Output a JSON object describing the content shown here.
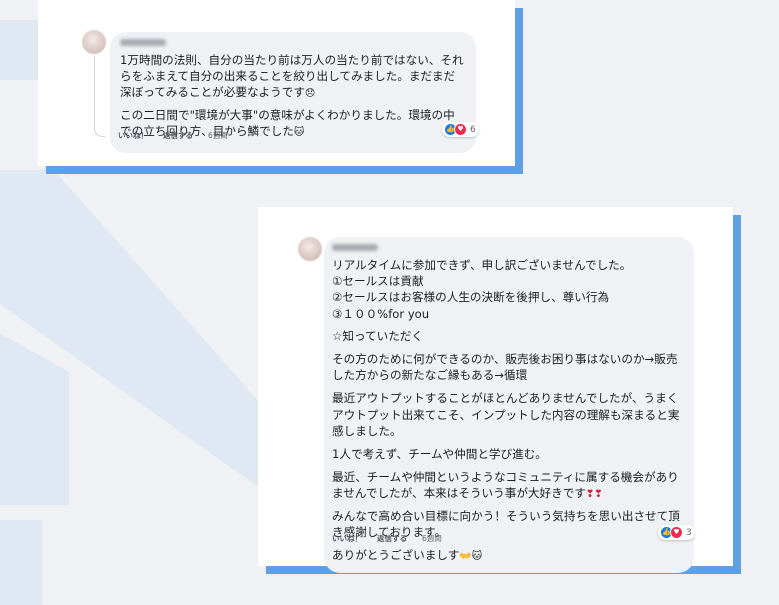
{
  "colors": {
    "page_bg": "#eff1f4",
    "card_shadow": "#5f9fe3",
    "bubble_bg": "#eff1f4",
    "like_blue": "#1877f2",
    "love_red": "#f0284a"
  },
  "comment1": {
    "author_blurred": true,
    "paragraphs": [
      "1万時間の法則、自分の当たり前は万人の当たり前ではない、それらをふまえて自分の出来ることを絞り出してみました。まだまだ深ぼってみることが必要なようです",
      "この二日間で\"環境が大事\"の意味がよくわかりました。環境の中での立ち回り方、目から鱗でした"
    ],
    "emoji": [
      "😞",
      "🐱"
    ],
    "reaction_count": "6",
    "actions": {
      "like": "いいね！",
      "reply": "返信する",
      "time": "6週間"
    }
  },
  "comment2": {
    "author_blurred": true,
    "lines": [
      "リアルタイムに参加できず、申し訳ございませんでした。",
      "①セールスは貢献",
      "②セールスはお客様の人生の決断を後押し、尊い行為",
      "③１００%for you"
    ],
    "paragraphs": [
      "☆知っていただく",
      "その方のために何ができるのか、販売後お困り事はないのか→販売した方からの新たなご縁もある→循環",
      "最近アウトプットすることがほとんどありませんでしたが、うまくアウトプット出来てこそ、インプットした内容の理解も深まると実感しました。",
      "1人で考えず、チームや仲間と学び進む。",
      "最近、チームや仲間というようなコミュニティに属する機会がありませんでしたが、本来はそういう事が大好きです",
      "みんなで高め合い目標に向かう！そういう気持ちを思い出させて頂き感謝しております。",
      "ありがとうございましす"
    ],
    "emoji": [
      "❣❣",
      "👐",
      "🐱"
    ],
    "reaction_count": "3",
    "actions": {
      "like": "いいね！",
      "reply": "返信する",
      "time": "6週間"
    }
  }
}
